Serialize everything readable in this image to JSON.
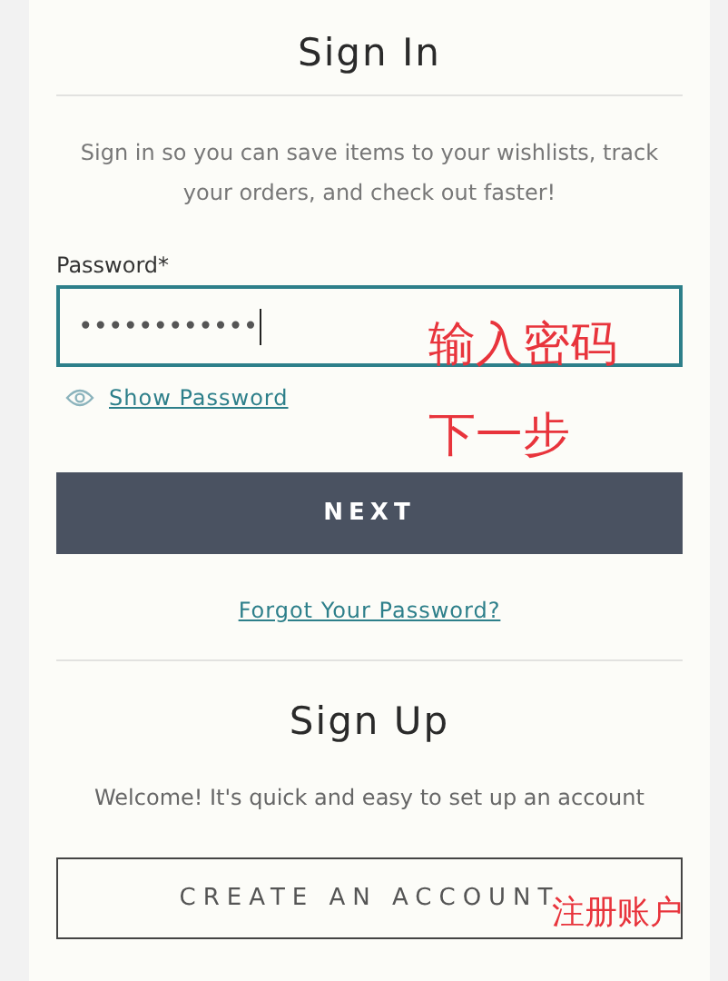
{
  "sign_in": {
    "title": "Sign In",
    "intro": "Sign in so you can save items to your wishlists, track your orders, and check out faster!",
    "password": {
      "label": "Password*",
      "value": "••••••••••••",
      "focused": true
    },
    "show_password": "Show Password",
    "next_button": "NEXT",
    "forgot_link": "Forgot Your Password?"
  },
  "sign_up": {
    "title": "Sign Up",
    "text": "Welcome! It's quick and easy to set up an account",
    "button": "CREATE AN ACCOUNT"
  },
  "annotations": [
    {
      "text": "输入密码",
      "color": "#e8343c"
    },
    {
      "text": "下一步",
      "color": "#e8343c"
    },
    {
      "text": "注册账户",
      "color": "#e8343c"
    }
  ]
}
